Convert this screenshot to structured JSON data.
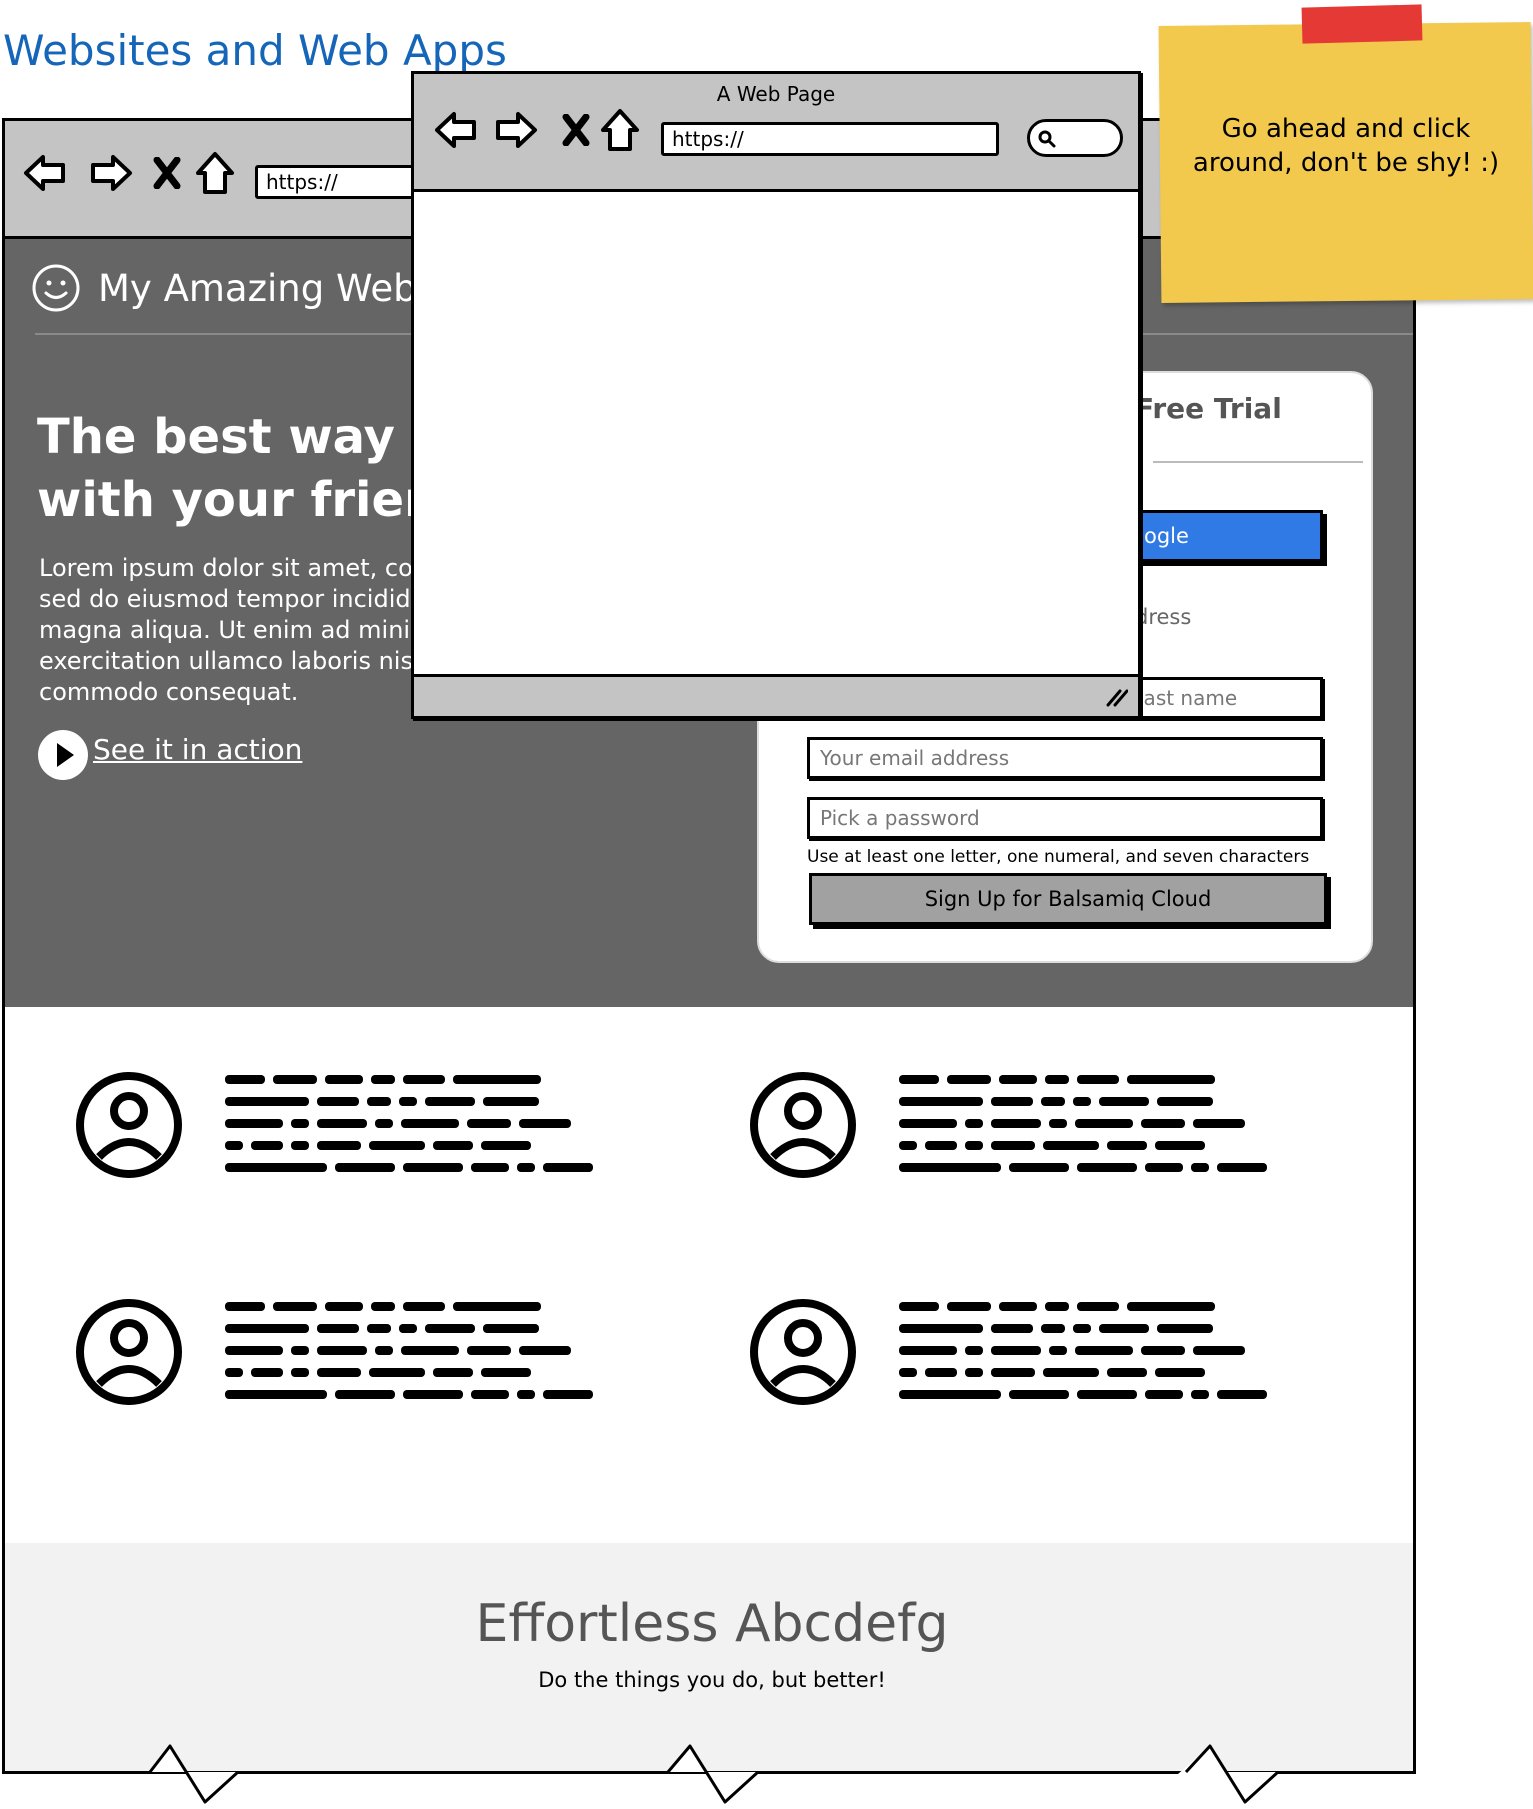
{
  "page_title": "Websites and Web Apps",
  "main_browser": {
    "url": "https://",
    "brand": "My Amazing Web App",
    "hero": {
      "title_line1": "The best way to",
      "title_line2": "with your friends",
      "body_lines": [
        "Lorem ipsum dolor sit amet, con",
        "sed do eiusmod tempor incididu",
        "magna aliqua. Ut enim ad minim",
        "exercitation ullamco laboris nisi",
        "commodo consequat."
      ],
      "cta": "See it in action"
    },
    "signup_card": {
      "title": "Free Trial",
      "google_button": "ogle",
      "or_email": "dress",
      "last_name_placeholder": "last name",
      "email_placeholder": "Your email address",
      "password_placeholder": "Pick a password",
      "password_hint": "Use at least one letter, one numeral, and seven characters",
      "submit_button": "Sign Up for Balsamiq Cloud"
    },
    "band": {
      "title": "Effortless Abcdefg",
      "subtitle": "Do the things you do, but better!"
    }
  },
  "popup_browser": {
    "title": "A Web Page",
    "url": "https://"
  },
  "sticky_note": {
    "line1": "Go ahead and click",
    "line2": "around, don't be shy! :)"
  },
  "colors": {
    "heading": "#1565b8",
    "toolbar": "#c4c4c4",
    "hero": "#656565",
    "google": "#2f7ae5",
    "sticky": "#f2c94c",
    "tape": "#e53935"
  },
  "icons": [
    "back-arrow-icon",
    "forward-arrow-icon",
    "stop-icon",
    "home-icon",
    "smiley-icon",
    "play-icon",
    "search-icon",
    "resize-grip-icon",
    "user-avatar-icon"
  ]
}
